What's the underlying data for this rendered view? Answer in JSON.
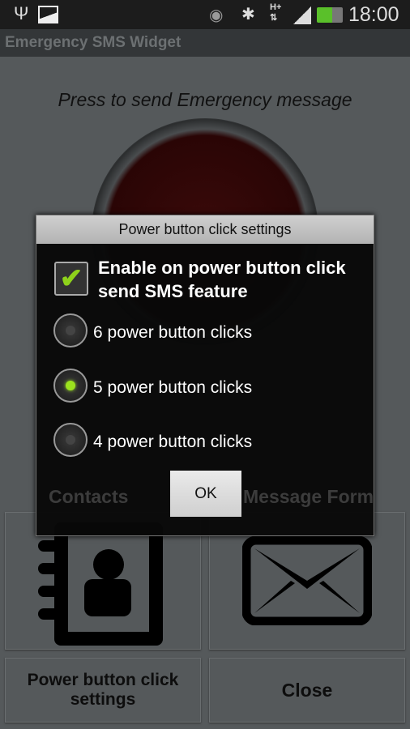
{
  "status_bar": {
    "time": "18:00",
    "icons": [
      "usb-icon",
      "image-icon",
      "eye-icon",
      "bluetooth-icon",
      "hplus-data-icon",
      "signal-icon",
      "battery-charging-icon"
    ],
    "network": "H+"
  },
  "app": {
    "title": "Emergency SMS Widget",
    "prompt": "Press to send Emergency message"
  },
  "tiles": {
    "contacts": "Contacts",
    "message_form": "Message Form",
    "power_settings": "Power button click settings",
    "close": "Close"
  },
  "dialog": {
    "title": "Power button click settings",
    "checkbox_label": "Enable on power button click send SMS feature",
    "checkbox_checked": true,
    "options": [
      {
        "label": "6 power button clicks",
        "selected": false
      },
      {
        "label": "5 power button clicks",
        "selected": true
      },
      {
        "label": "4 power button clicks",
        "selected": false
      }
    ],
    "ok": "OK"
  },
  "colors": {
    "accent": "#9be21e",
    "emergency_button": "#5a0a0a"
  }
}
